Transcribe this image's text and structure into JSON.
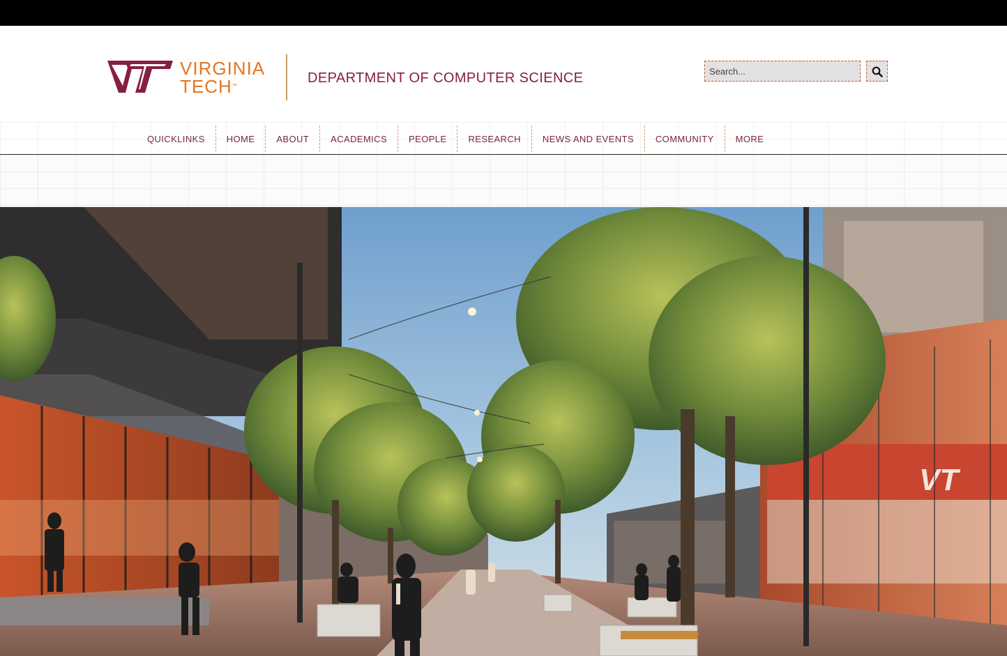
{
  "brand": {
    "university_line1": "VIRGINIA",
    "university_line2": "TECH",
    "trademark": "™",
    "department": "DEPARTMENT OF COMPUTER SCIENCE",
    "colors": {
      "maroon": "#861f41",
      "orange": "#e5751f"
    }
  },
  "search": {
    "placeholder": "Search...",
    "value": "",
    "icon": "search-icon"
  },
  "nav": {
    "items": [
      {
        "label": "QUICKLINKS"
      },
      {
        "label": "HOME"
      },
      {
        "label": "ABOUT"
      },
      {
        "label": "ACADEMICS"
      },
      {
        "label": "PEOPLE"
      },
      {
        "label": "RESEARCH"
      },
      {
        "label": "NEWS AND EVENTS"
      },
      {
        "label": "COMMUNITY"
      },
      {
        "label": "MORE"
      }
    ]
  },
  "hero": {
    "kind": "architectural rendering of a tree-lined campus street with glass buildings and pedestrians",
    "sign_text": "VT"
  }
}
